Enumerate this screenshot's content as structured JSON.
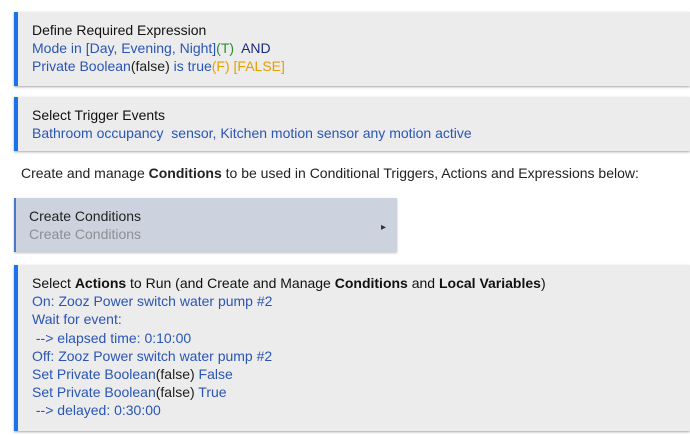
{
  "expression": {
    "title": "Define Required Expression",
    "line1_label": "Mode in [Day, Evening, Night]",
    "line1_result": "(T)",
    "line1_op": "AND",
    "line2_label": "Private Boolean",
    "line2_value": "(false)",
    "line2_cond": " is true",
    "line2_result": "(F)",
    "line2_final": "[FALSE]"
  },
  "triggers": {
    "title": "Select Trigger Events",
    "value": "Bathroom occupancy  sensor, Kitchen motion sensor any motion active"
  },
  "info": {
    "prefix": "Create and manage ",
    "bold": "Conditions",
    "suffix": " to be used in Conditional Triggers, Actions and Expressions below:"
  },
  "conditions_button": {
    "label": "Create Conditions",
    "sublabel": "Create Conditions",
    "arrow": "▸"
  },
  "actions": {
    "title_1": "Select ",
    "title_2": "Actions",
    "title_3": " to Run (and Create and Manage ",
    "title_4": "Conditions",
    "title_5": " and ",
    "title_6": "Local Variables",
    "title_7": ")",
    "line1": "On: Zooz Power switch water pump #2",
    "line2": "Wait for event:",
    "line3": " --> elapsed time: 0:10:00",
    "line4": "Off: Zooz Power switch water pump #2",
    "line5_label": "Set Private Boolean",
    "line5_value": "(false)",
    "line5_result": " False",
    "line6_label": "Set Private Boolean",
    "line6_value": "(false)",
    "line6_result": " True",
    "line7": " --> delayed: 0:30:00"
  },
  "colors": {
    "accent": "#1a73e8",
    "link_blue": "#2a55b4",
    "true_green": "#2e8b2e",
    "false_orange": "#e5a000",
    "panel_bg": "#ececec",
    "button_bg": "#ccd2de"
  }
}
